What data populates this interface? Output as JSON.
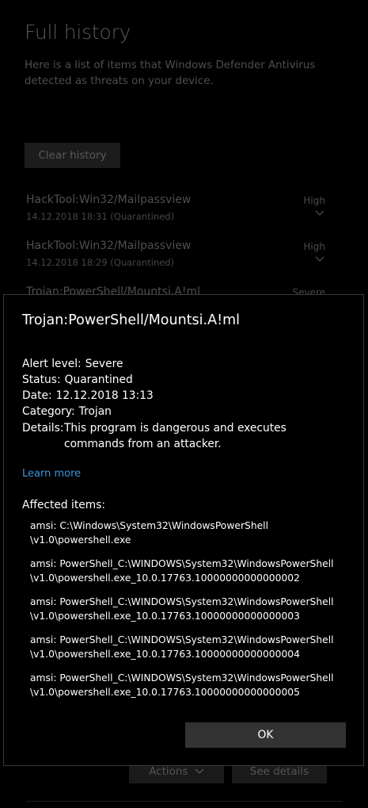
{
  "page": {
    "title": "Full history",
    "description": "Here is a list of items that Windows Defender Antivirus detected as threats on your device.",
    "clear_label": "Clear history",
    "threats": [
      {
        "name": "HackTool:Win32/Mailpassview",
        "meta": "14.12.2018 18:31 (Quarantined)",
        "severity": "High"
      },
      {
        "name": "HackTool:Win32/Mailpassview",
        "meta": "14.12.2018 18:29 (Quarantined)",
        "severity": "High"
      },
      {
        "name": "Trojan:PowerShell/Mountsi.A!ml",
        "meta": "",
        "severity": "Severe"
      }
    ],
    "actions_label": "Actions",
    "see_details_label": "See details"
  },
  "dialog": {
    "title": "Trojan:PowerShell/Mountsi.A!ml",
    "alert_label": "Alert level:",
    "alert_value": "Severe",
    "status_label": "Status:",
    "status_value": "Quarantined",
    "date_label": "Date:",
    "date_value": "12.12.2018 13:13",
    "category_label": "Category:",
    "category_value": "Trojan",
    "details_label": "Details:",
    "details_value": "This program is dangerous and executes commands from an attacker.",
    "learn_more": "Learn more",
    "affected_label": "Affected items:",
    "affected": [
      "amsi: C:\\Windows\\System32\\WindowsPowerShell\n\\v1.0\\powershell.exe",
      "amsi: PowerShell_C:\\WINDOWS\\System32\\WindowsPowerShell\n\\v1.0\\powershell.exe_10.0.17763.10000000000000002",
      "amsi: PowerShell_C:\\WINDOWS\\System32\\WindowsPowerShell\n\\v1.0\\powershell.exe_10.0.17763.10000000000000003",
      "amsi: PowerShell_C:\\WINDOWS\\System32\\WindowsPowerShell\n\\v1.0\\powershell.exe_10.0.17763.10000000000000004",
      "amsi: PowerShell_C:\\WINDOWS\\System32\\WindowsPowerShell\n\\v1.0\\powershell.exe_10.0.17763.10000000000000005"
    ],
    "ok_label": "OK"
  }
}
